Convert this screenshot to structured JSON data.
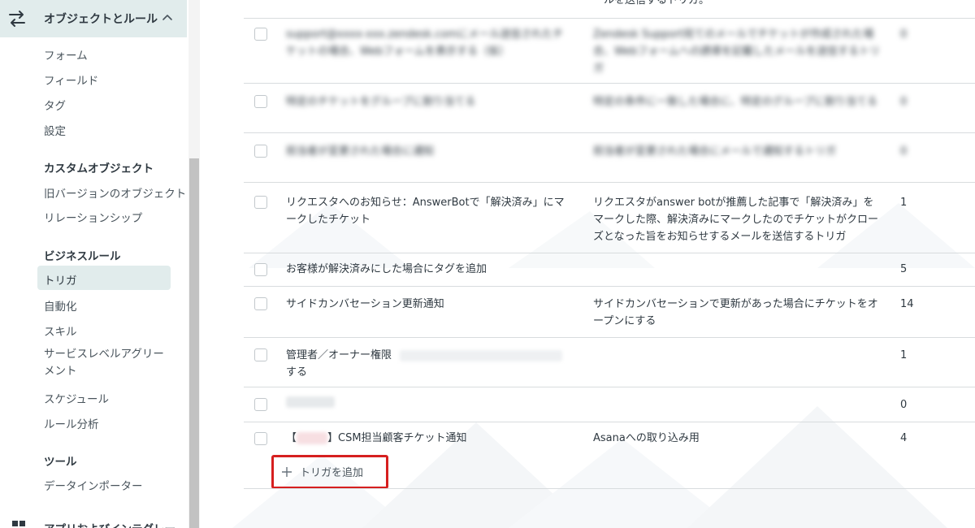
{
  "sidebar": {
    "header": {
      "label": "オブジェクトとルール"
    },
    "objects_items": [
      "フォーム",
      "フィールド",
      "タグ",
      "設定"
    ],
    "custom_objects": {
      "title": "カスタムオブジェクト",
      "items": [
        "旧バージョンのオブジェクト",
        "リレーションシップ"
      ]
    },
    "business_rules": {
      "title": "ビジネスルール",
      "items": [
        "トリガ",
        "自動化",
        "スキル",
        "サービスレベルアグリーメント",
        "スケジュール",
        "ルール分析"
      ]
    },
    "tools": {
      "title": "ツール",
      "items": [
        "データインポーター"
      ]
    },
    "bottom_partial": "アプリおよびインテグレー"
  },
  "table": {
    "top_partial_desc": "ールを送信するトリガ。",
    "rows": [
      {
        "name": "support@xxxx-xxx.zendesk.comにメール送信されたチケットの場合、Webフォームを表示する（仮）",
        "desc": "Zendesk Support宛てのメールでチケットが作成された場合、Webフォームへの誘導を記載したメールを送信するトリガ",
        "count": "0",
        "blurred": true
      },
      {
        "name": "特定のチケットをグループに割り当てる",
        "desc": "特定の条件に一致した場合に、特定のグループに割り当てる",
        "count": "0",
        "blurred": true
      },
      {
        "name": "担当者が変更された場合に通知",
        "desc": "担当者が変更された場合にメールで通知するトリガ",
        "count": "0",
        "blurred": true
      },
      {
        "name": "リクエスタへのお知らせ：AnswerBotで「解決済み」にマークしたチケット",
        "desc": "リクエスタがanswer botが推薦した記事で「解決済み」をマークした際、解決済みにマークしたのでチケットがクローズとなった旨をお知らせするメールを送信するトリガ",
        "count": "1",
        "blurred": false
      },
      {
        "name": "お客様が解決済みにした場合にタグを追加",
        "desc": "",
        "count": "5",
        "blurred": false
      },
      {
        "name": "サイドカンバセーション更新通知",
        "desc": "サイドカンバセーションで更新があった場合にチケットをオープンにする",
        "count": "14",
        "blurred": false
      },
      {
        "name_prefix": "管理者／オーナー権限",
        "name_suffix": "する",
        "desc": "",
        "count": "1",
        "blurred": false
      },
      {
        "name": "",
        "desc": "",
        "count": "0",
        "blurred": true
      },
      {
        "name_open": "【",
        "name_rest": "】CSM担当顧客チケット通知",
        "desc": "Asanaへの取り込み用",
        "count": "4",
        "blurred": false
      }
    ],
    "add_button_label": "トリガを追加"
  },
  "colors": {
    "accent_bg": "#e1ecec",
    "highlight_border": "#d61f1f"
  },
  "icons": {
    "header": "rules-icon",
    "chevron": "chevron-up-icon",
    "add": "plus-icon"
  }
}
